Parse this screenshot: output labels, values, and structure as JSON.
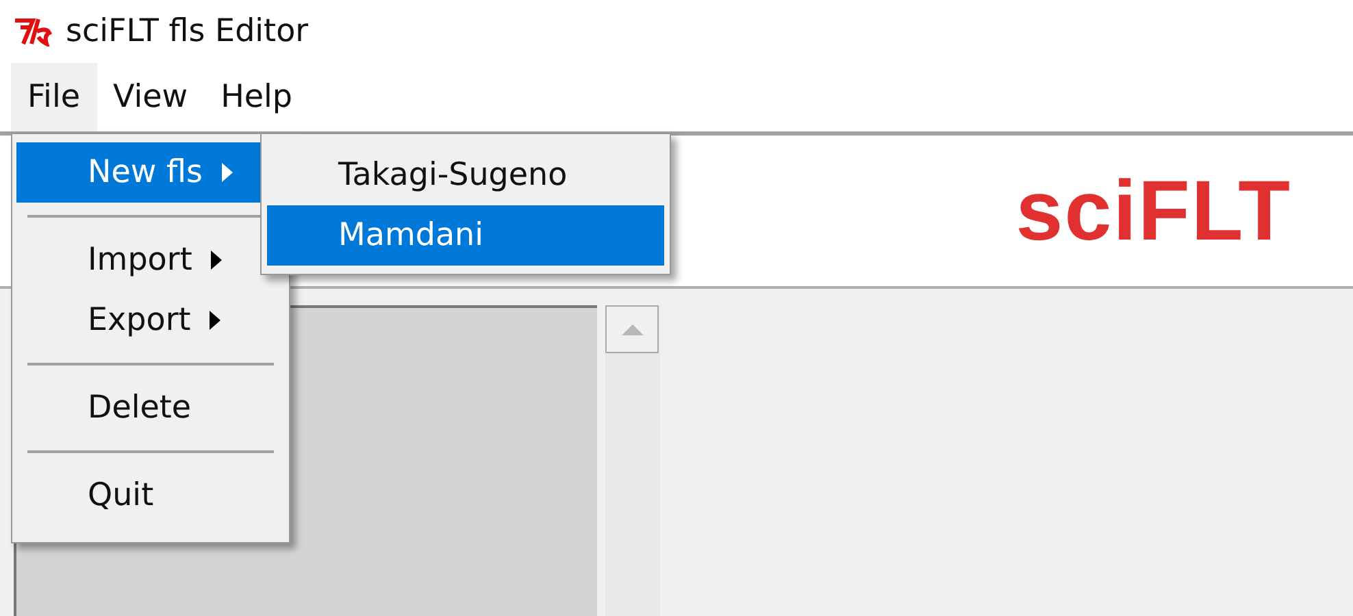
{
  "window": {
    "title": "sciFLT fls Editor"
  },
  "menubar": [
    {
      "label": "File",
      "selected": true
    },
    {
      "label": "View",
      "selected": false
    },
    {
      "label": "Help",
      "selected": false
    }
  ],
  "file_menu": [
    {
      "kind": "item",
      "label": "New fls",
      "submenu": true,
      "selected": true
    },
    {
      "kind": "separator"
    },
    {
      "kind": "item",
      "label": "Import",
      "submenu": true,
      "selected": false
    },
    {
      "kind": "item",
      "label": "Export",
      "submenu": true,
      "selected": false
    },
    {
      "kind": "separator"
    },
    {
      "kind": "item",
      "label": "Delete",
      "submenu": false,
      "selected": false
    },
    {
      "kind": "separator"
    },
    {
      "kind": "item",
      "label": "Quit",
      "submenu": false,
      "selected": false
    }
  ],
  "submenu": [
    {
      "label": "Takagi-Sugeno",
      "selected": false
    },
    {
      "label": "Mamdani",
      "selected": true
    }
  ],
  "banner": {
    "logo": "sciFLT"
  }
}
